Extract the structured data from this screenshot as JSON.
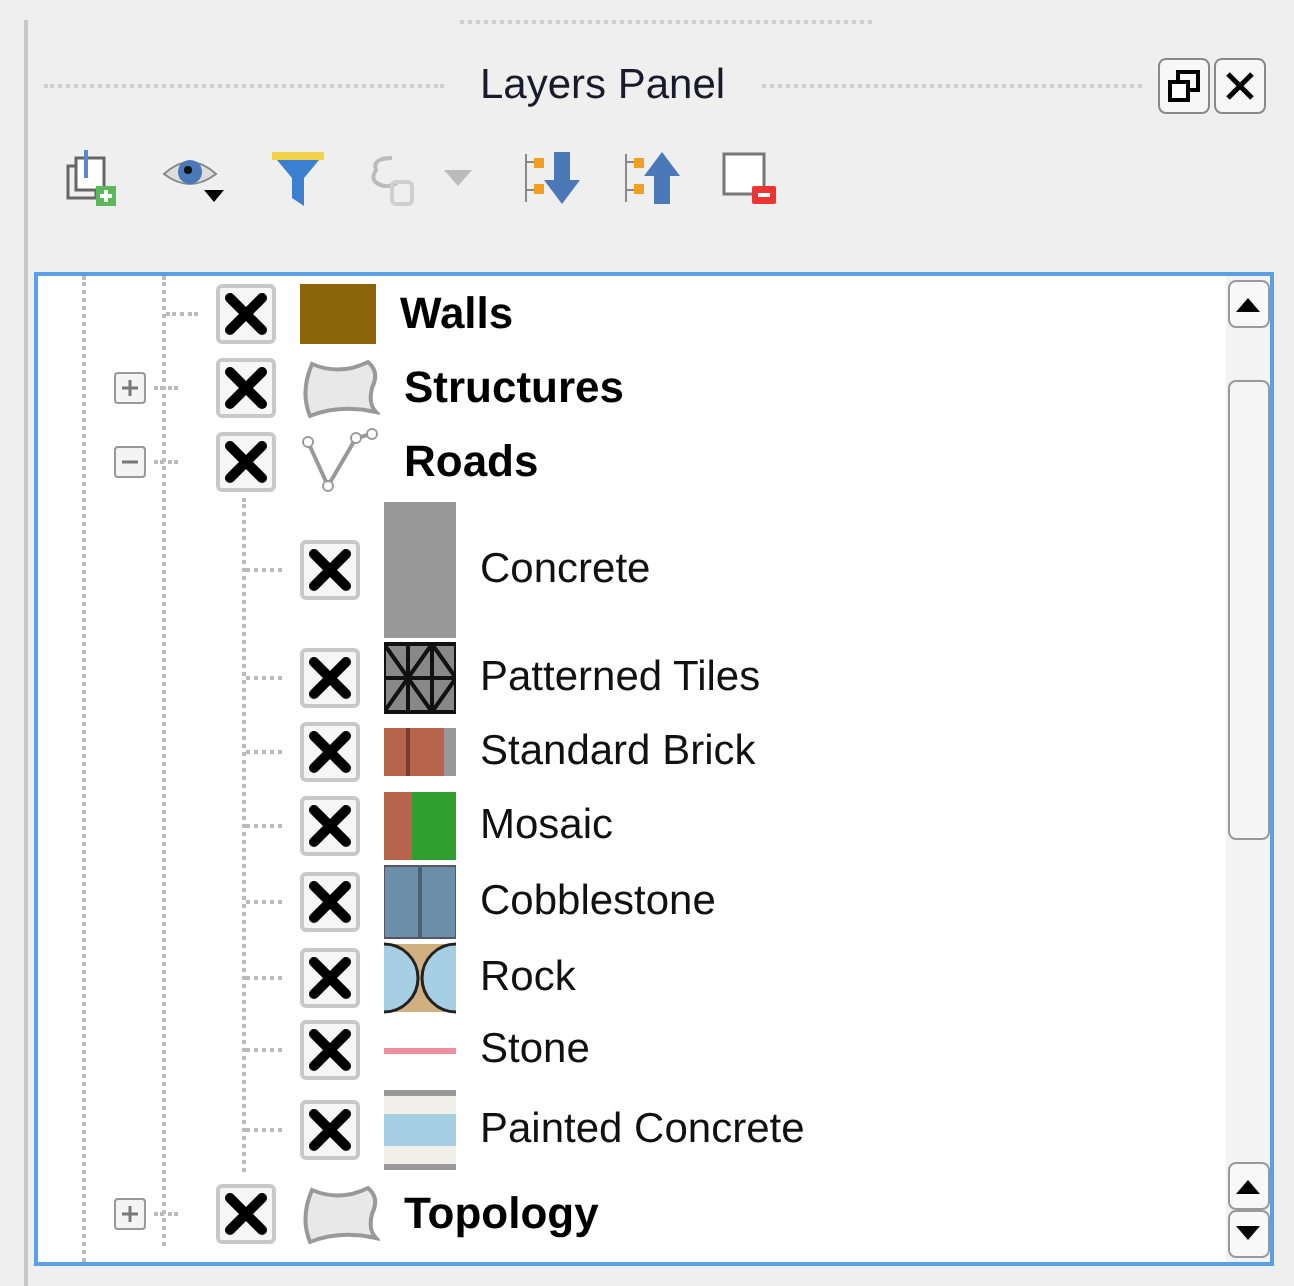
{
  "panel": {
    "title": "Layers Panel"
  },
  "toolbar": [
    {
      "kind": "add_group",
      "disabled": false
    },
    {
      "kind": "visibility",
      "disabled": false
    },
    {
      "kind": "filter",
      "disabled": false
    },
    {
      "kind": "expression",
      "disabled": true
    },
    {
      "kind": "expand_all",
      "disabled": false
    },
    {
      "kind": "collapse_all",
      "disabled": false
    },
    {
      "kind": "remove",
      "disabled": false
    }
  ],
  "layers": [
    {
      "label": "Walls",
      "checked": true,
      "kind": "fill"
    },
    {
      "label": "Structures",
      "checked": true,
      "kind": "polygon",
      "expanded": false
    },
    {
      "label": "Roads",
      "checked": true,
      "kind": "line_vertices",
      "expanded": true,
      "children": [
        {
          "label": "Concrete",
          "checked": true,
          "kind": "concrete"
        },
        {
          "label": "Patterned Tiles",
          "checked": true,
          "kind": "pattern"
        },
        {
          "label": "Standard Brick",
          "checked": true,
          "kind": "brick"
        },
        {
          "label": "Mosaic",
          "checked": true,
          "kind": "mosaic"
        },
        {
          "label": "Cobblestone",
          "checked": true,
          "kind": "cobble"
        },
        {
          "label": "Rock",
          "checked": true,
          "kind": "rock"
        },
        {
          "label": "Stone",
          "checked": true,
          "kind": "line"
        },
        {
          "label": "Painted Concrete",
          "checked": true,
          "kind": "painted"
        }
      ]
    },
    {
      "label": "Topology",
      "checked": true,
      "kind": "polygon",
      "expanded": false
    }
  ]
}
